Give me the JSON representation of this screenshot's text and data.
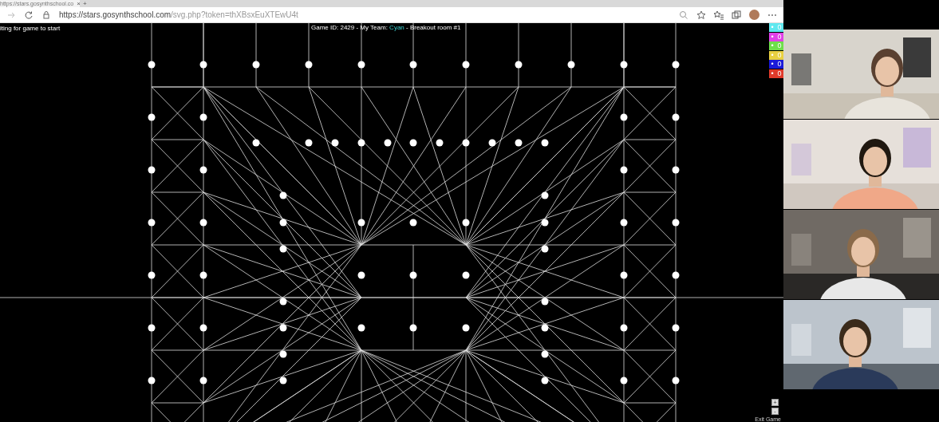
{
  "browser": {
    "tab_title": "https://stars.gosynthschool.co",
    "tab_close": "×",
    "new_tab": "+",
    "url_host": "https://stars.gosynthschool.com",
    "url_path": "/svg.php?token=thXBsxEuXTEwU4t",
    "more": "⋯"
  },
  "game": {
    "status": "iting for game to start",
    "header_prefix": "Game ID: 2429 - My Team: ",
    "team": "Cyan",
    "header_suffix": " - Breakout room #1"
  },
  "scores": [
    {
      "color": "#5fe8ef",
      "marker": "•",
      "value": "0"
    },
    {
      "color": "#e040e8",
      "marker": "•",
      "value": "0"
    },
    {
      "color": "#6ee04a",
      "marker": "•",
      "value": "0"
    },
    {
      "color": "#e8d040",
      "marker": "•",
      "value": "0"
    },
    {
      "color": "#1a1ad8",
      "marker": "•",
      "value": "0"
    },
    {
      "color": "#e03a2a",
      "marker": "•",
      "value": "0"
    }
  ],
  "zoom_controls": [
    "+",
    "-"
  ],
  "exit_label": "Exit Game"
}
